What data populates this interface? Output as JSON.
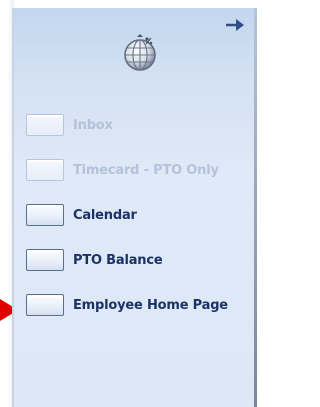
{
  "menu": {
    "items": [
      {
        "label": "Inbox",
        "state": "disabled"
      },
      {
        "label": "Timecard - PTO Only",
        "state": "disabled"
      },
      {
        "label": "Calendar",
        "state": "enabled"
      },
      {
        "label": "PTO Balance",
        "state": "enabled"
      },
      {
        "label": "Employee Home Page",
        "state": "enabled"
      }
    ]
  },
  "icons": {
    "header": "globe-icon",
    "corner": "arrow-right-icon",
    "pointer": "red-pointer-arrow-icon"
  },
  "colors": {
    "panel_top": "#c3d6ee",
    "panel_bottom": "#dde8f6",
    "label_enabled": "#1b3364",
    "label_disabled": "#b3c3da",
    "pointer": "#e00000"
  }
}
